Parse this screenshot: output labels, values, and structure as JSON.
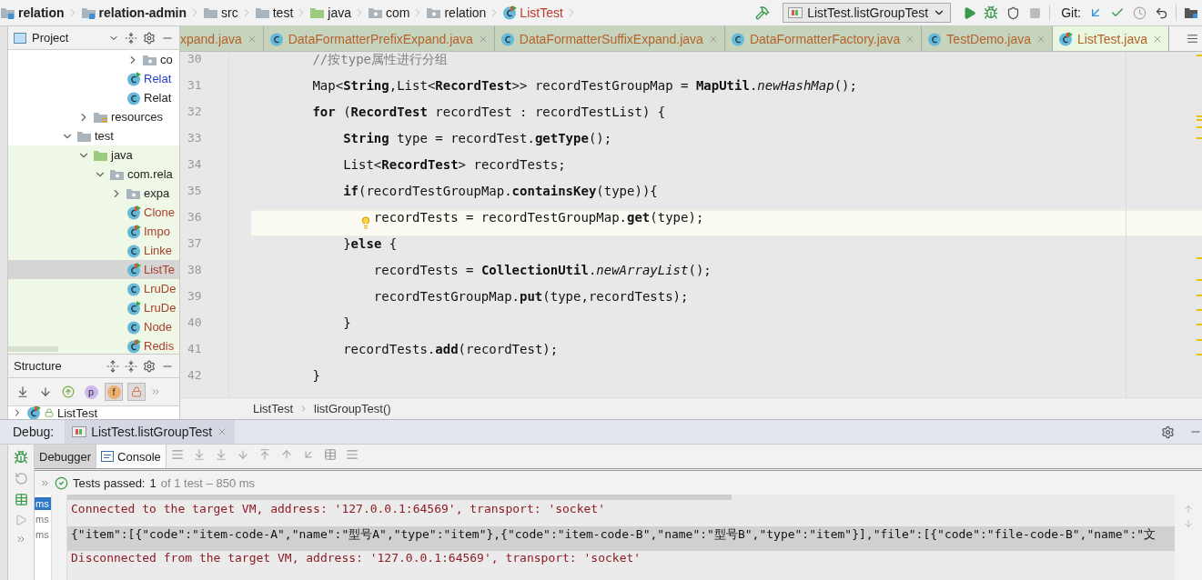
{
  "nav_bar": {
    "breadcrumbs": [
      {
        "label": "relation",
        "kind": "module"
      },
      {
        "label": "relation-admin",
        "kind": "module"
      },
      {
        "label": "src",
        "kind": "folder"
      },
      {
        "label": "test",
        "kind": "folder"
      },
      {
        "label": "java",
        "kind": "source-folder"
      },
      {
        "label": "com",
        "kind": "package"
      },
      {
        "label": "relation",
        "kind": "package"
      },
      {
        "label": "ListTest",
        "kind": "class"
      }
    ],
    "run_config": "ListTest.listGroupTest",
    "vcs_label": "Git:"
  },
  "project_panel": {
    "title": "Project",
    "tree": [
      {
        "children": [
          {
            "children": [
              {
                "children": [
                  {
                    "children": [
                      {
                        "label": "co",
                        "kind": "package",
                        "expanded": false,
                        "selected": false,
                        "tinted": false
                      }
                    ]
                  },
                  {
                    "label": "Relat",
                    "kind": "class",
                    "run_marker": true,
                    "test_marker": false,
                    "color": "#1f3fc4",
                    "selected": false,
                    "tinted": false
                  },
                  {
                    "label": "Relat",
                    "kind": "class",
                    "run_marker": false,
                    "test_marker": false,
                    "color": "#222222",
                    "selected": false,
                    "tinted": false
                  }
                ]
              }
            ]
          },
          {
            "label": "resources",
            "kind": "resources-folder",
            "expanded": false,
            "selected": false,
            "tinted": false
          }
        ]
      },
      {
        "label": "test",
        "kind": "folder",
        "expanded": true,
        "selected": false,
        "tinted": false,
        "children": [
          {
            "label": "java",
            "kind": "source-folder",
            "expanded": true,
            "selected": false,
            "tinted": true,
            "children": [
              {
                "label": "com.rela",
                "kind": "package",
                "expanded": true,
                "selected": false,
                "tinted": true,
                "children": [
                  {
                    "label": "expa",
                    "kind": "package",
                    "expanded": false,
                    "selected": false,
                    "tinted": true
                  },
                  {
                    "label": "Clone",
                    "kind": "class",
                    "run_marker": true,
                    "test_marker": true,
                    "color": "#a6402a",
                    "selected": false,
                    "tinted": true
                  },
                  {
                    "label": "Impo",
                    "kind": "class",
                    "run_marker": true,
                    "test_marker": true,
                    "color": "#a6402a",
                    "selected": false,
                    "tinted": true
                  },
                  {
                    "label": "Linke",
                    "kind": "class",
                    "run_marker": false,
                    "test_marker": false,
                    "color": "#a6402a",
                    "selected": false,
                    "tinted": true
                  },
                  {
                    "label": "ListTe",
                    "kind": "class",
                    "run_marker": true,
                    "test_marker": true,
                    "color": "#a6402a",
                    "selected": true,
                    "tinted": true
                  },
                  {
                    "label": "LruDe",
                    "kind": "class",
                    "run_marker": false,
                    "test_marker": false,
                    "color": "#a6402a",
                    "selected": false,
                    "tinted": true
                  },
                  {
                    "label": "LruDe",
                    "kind": "class",
                    "run_marker": true,
                    "test_marker": false,
                    "color": "#a6402a",
                    "selected": false,
                    "tinted": true
                  },
                  {
                    "label": "Node",
                    "kind": "class",
                    "run_marker": false,
                    "test_marker": false,
                    "color": "#a6402a",
                    "selected": false,
                    "tinted": true
                  },
                  {
                    "label": "Redis",
                    "kind": "class",
                    "run_marker": true,
                    "test_marker": true,
                    "color": "#a6402a",
                    "selected": false,
                    "tinted": true
                  }
                ]
              }
            ]
          }
        ]
      }
    ]
  },
  "structure_panel": {
    "title": "Structure",
    "toolbar": [
      {
        "kind": "sort-visibility",
        "selected": false
      },
      {
        "kind": "sort-alpha",
        "selected": false
      },
      {
        "kind": "inherited",
        "selected": false
      },
      {
        "kind": "letter",
        "label": "p",
        "selected": false
      },
      {
        "kind": "letter",
        "label": "f",
        "selected": true
      },
      {
        "kind": "lock",
        "selected": true
      }
    ],
    "tree": [
      {
        "label": "ListTest",
        "expanded": false
      }
    ]
  },
  "editor": {
    "tabs": [
      {
        "label": "xpand.java",
        "selected": false
      },
      {
        "label": "DataFormatterPrefixExpand.java",
        "selected": false
      },
      {
        "label": "DataFormatterSuffixExpand.java",
        "selected": false
      },
      {
        "label": "DataFormatterFactory.java",
        "selected": false
      },
      {
        "label": "TestDemo.java",
        "selected": false
      },
      {
        "label": "ListTest.java",
        "selected": true
      }
    ],
    "lines": [
      {
        "number": "30",
        "kind": "comment",
        "current": false,
        "bulb": false,
        "text": "        //按type属性进行分组"
      },
      {
        "number": "31",
        "kind": "code",
        "current": false,
        "bulb": false,
        "text": "        Map<**String**,List<**RecordTest**>> recordTestGroupMap = **MapUtil**.*newHashMap*();"
      },
      {
        "number": "32",
        "kind": "code",
        "current": false,
        "bulb": false,
        "text": "        **for** (**RecordTest** recordTest : recordTestList) {"
      },
      {
        "number": "33",
        "kind": "code",
        "current": false,
        "bulb": false,
        "text": "            **String** type = recordTest.**getType**();"
      },
      {
        "number": "34",
        "kind": "code",
        "current": false,
        "bulb": false,
        "text": "            List<**RecordTest**> recordTests;"
      },
      {
        "number": "35",
        "kind": "code",
        "current": false,
        "bulb": false,
        "text": "            **if**(recordTestGroupMap.**containsKey**(type)){"
      },
      {
        "number": "36",
        "kind": "code",
        "current": true,
        "bulb": true,
        "text": "                recordTests = recordTestGroupMap.**get**(type);"
      },
      {
        "number": "37",
        "kind": "code",
        "current": false,
        "bulb": false,
        "text": "            }**else** {"
      },
      {
        "number": "38",
        "kind": "code",
        "current": false,
        "bulb": false,
        "text": "                recordTests = **CollectionUtil**.*newArrayList*();"
      },
      {
        "number": "39",
        "kind": "code",
        "current": false,
        "bulb": false,
        "text": "                recordTestGroupMap.**put**(type,recordTests);"
      },
      {
        "number": "40",
        "kind": "code",
        "current": false,
        "bulb": false,
        "text": "            }"
      },
      {
        "number": "41",
        "kind": "code",
        "current": false,
        "bulb": false,
        "text": "            recordTests.**add**(recordTest);"
      },
      {
        "number": "42",
        "kind": "code",
        "current": false,
        "bulb": false,
        "text": "        }"
      }
    ],
    "breadcrumbs": [
      "ListTest",
      "listGroupTest()"
    ]
  },
  "debug_panel": {
    "label": "Debug:",
    "session_tab": "ListTest.listGroupTest",
    "tabs": [
      {
        "label": "Debugger",
        "selected": false
      },
      {
        "label": "Console",
        "selected": true
      }
    ],
    "status": {
      "label": "Tests passed:",
      "count": "1",
      "detail": "of 1 test – 850 ms"
    },
    "timings": [
      {
        "label": "ms",
        "selected": true
      },
      {
        "label": "ms",
        "selected": false
      },
      {
        "label": "ms",
        "selected": false
      }
    ],
    "console": [
      {
        "kind": "system",
        "selected": false,
        "text": "Connected to the target VM, address: '127.0.0.1:64569', transport: 'socket'"
      },
      {
        "kind": "output",
        "selected": true,
        "text": "{\"item\":[{\"code\":\"item-code-A\",\"name\":\"型号A\",\"type\":\"item\"},{\"code\":\"item-code-B\",\"name\":\"型号B\",\"type\":\"item\"}],\"file\":[{\"code\":\"file-code-B\",\"name\":\"文"
      },
      {
        "kind": "system",
        "selected": false,
        "text": "Disconnected from the target VM, address: '127.0.0.1:64569', transport: 'socket'"
      }
    ]
  }
}
